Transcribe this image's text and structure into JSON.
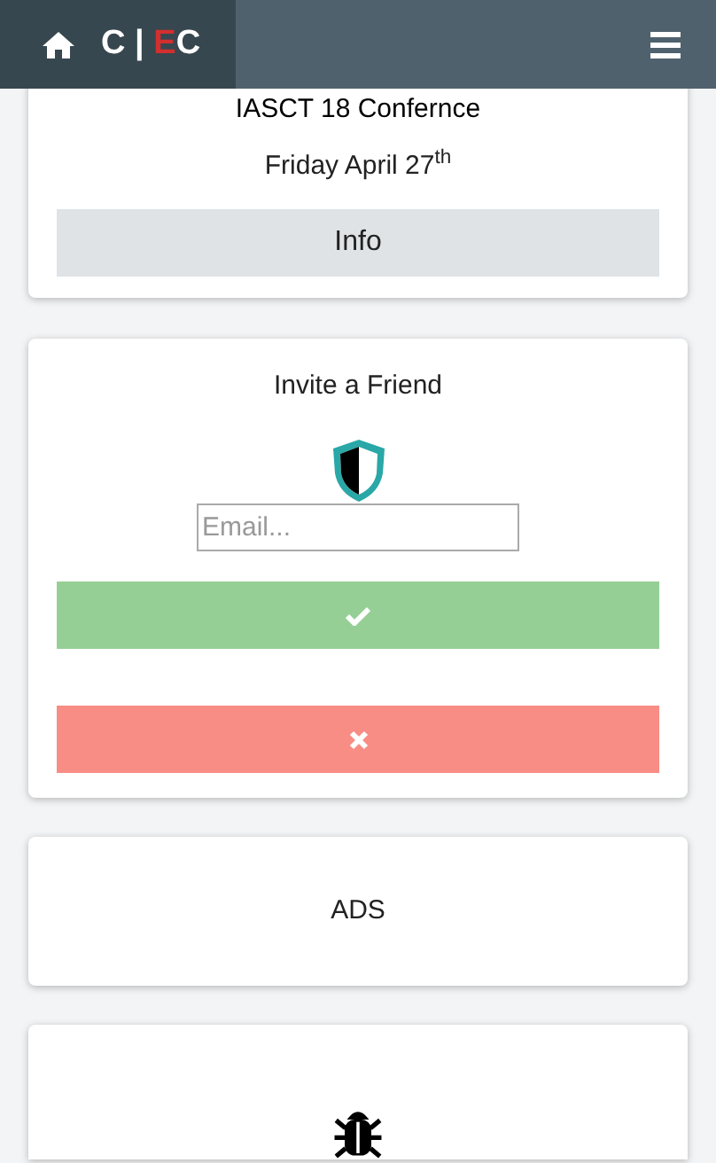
{
  "header": {
    "logo": {
      "left": "C",
      "separator": "|",
      "accent": "E",
      "right": "C"
    }
  },
  "event_card": {
    "title": "IASCT 18 Confernce",
    "date": "Friday April 27$^{th}$",
    "button": "Info"
  },
  "invite_card": {
    "title": "Invite a Friend",
    "email": {
      "placeholder": "Email..."
    }
  },
  "ads_card": {
    "text": "ADS"
  }
}
